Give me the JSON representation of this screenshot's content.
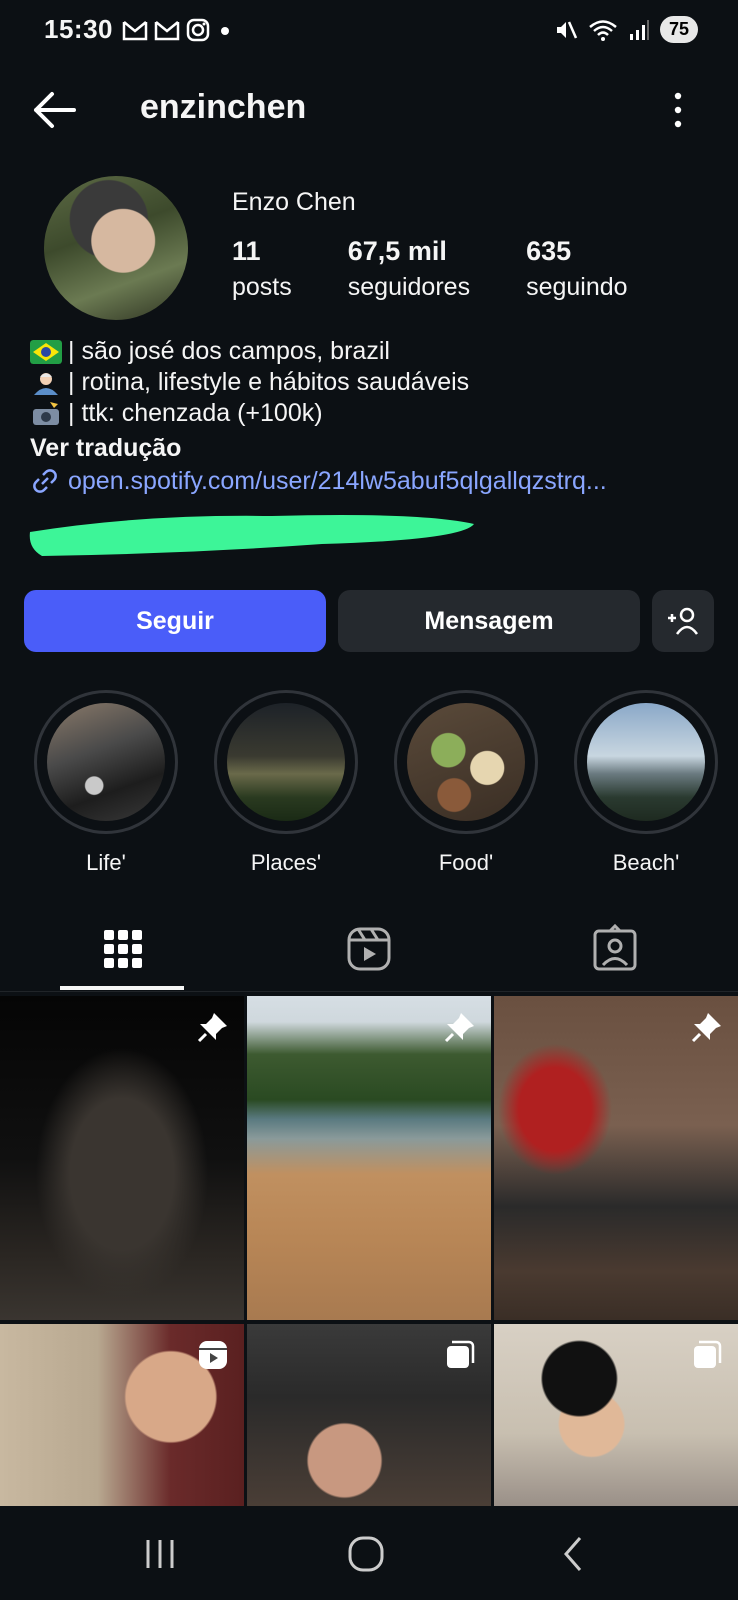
{
  "status_bar": {
    "time": "15:30",
    "battery": "75",
    "notification_icons": [
      "gmail-icon",
      "gmail-icon",
      "instagram-icon",
      "dot-icon"
    ],
    "system_icons": [
      "mute-icon",
      "wifi-icon",
      "signal-icon"
    ]
  },
  "header": {
    "username": "enzinchen"
  },
  "profile": {
    "full_name": "Enzo Chen",
    "stats": [
      {
        "value": "11",
        "label": "posts"
      },
      {
        "value": "67,5 mil",
        "label": "seguidores"
      },
      {
        "value": "635",
        "label": "seguindo"
      }
    ],
    "bio": [
      {
        "icon": "brazil-flag-icon",
        "text": "| são josé dos campos, brazil"
      },
      {
        "icon": "person-emoji-icon",
        "text": "| rotina, lifestyle e hábitos saudáveis"
      },
      {
        "icon": "camera-flash-emoji-icon",
        "text": "| ttk: chenzada (+100k)"
      }
    ],
    "see_translation": "Ver tradução",
    "link": "open.spotify.com/user/214lw5abuf5qlgallqzstrq..."
  },
  "actions": {
    "follow": "Seguir",
    "message": "Mensagem"
  },
  "highlights": [
    {
      "label": "Life'"
    },
    {
      "label": "Places'"
    },
    {
      "label": "Food'"
    },
    {
      "label": "Beach'"
    }
  ],
  "colors": {
    "background": "#0c1014",
    "accent": "#4a5df9",
    "link": "#8aa6ff",
    "secondary_button": "#25292e",
    "scribble": "#3df598"
  }
}
